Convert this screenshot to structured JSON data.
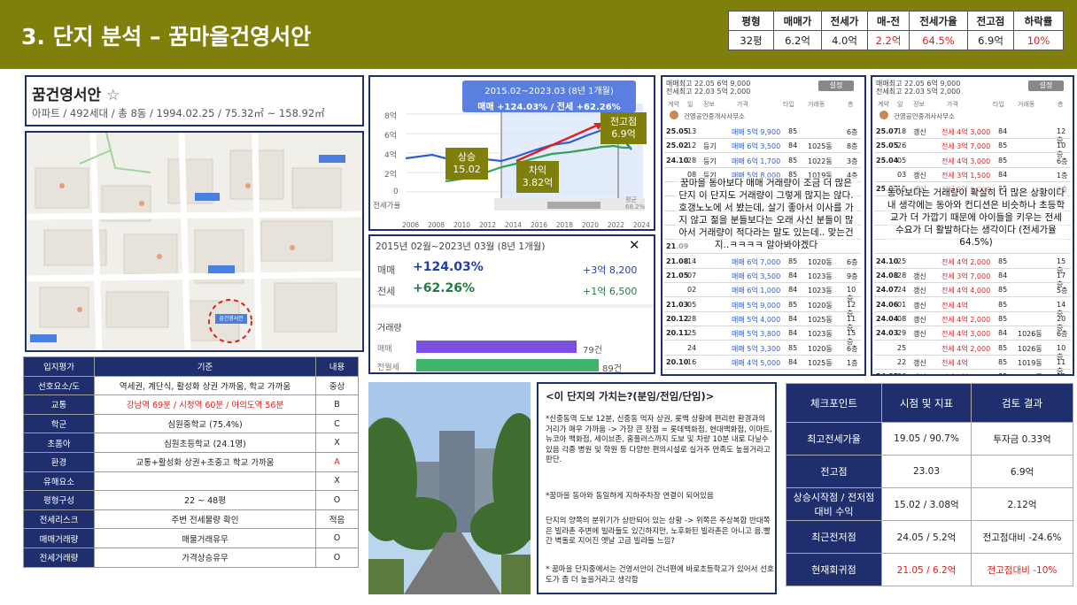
{
  "header": {
    "title": "3. 단지 분석 – 꿈마을건영서안"
  },
  "stats": {
    "headers": [
      "평형",
      "매매가",
      "전세가",
      "매-전",
      "전세가율",
      "전고점",
      "하락률"
    ],
    "values": [
      "32평",
      "6.2억",
      "4.0억",
      "2.2억",
      "64.5%",
      "6.9억",
      "10%"
    ]
  },
  "info": {
    "name": "꿈건영서안",
    "star": "☆",
    "desc": "아파트 / 492세대 / 총 8동 / 1994.02.25 / 75.32㎡ ~ 158.92㎡"
  },
  "map": {
    "pin": "꿈건영서안"
  },
  "price_chart": {
    "tooltip_period": "2015.02~2023.03 (8년 1개월)",
    "tooltip_change": "매매 +124.03% / 전세 +62.26%",
    "y_ticks": [
      "8억",
      "6억",
      "4억",
      "2억",
      "0"
    ],
    "y_label": "전세가율",
    "x_ticks": [
      "2006",
      "2008",
      "2010",
      "2012",
      "2014",
      "2016",
      "2018",
      "2020",
      "2022",
      "2024"
    ],
    "right_label": "평균",
    "right_value": "68.2%",
    "callouts": {
      "rise": "상승\n15.02",
      "gap": "차익\n3.82억",
      "peak": "전고점\n6.9억"
    }
  },
  "change_panel": {
    "period": "2015년 02월~2023년 03월 (8년 1개월)",
    "close": "✕",
    "sale_label": "매매",
    "sale_pct": "+124.03%",
    "sale_amt": "+3억 8,200",
    "jeonse_label": "전세",
    "jeonse_pct": "+62.26%",
    "jeonse_amt": "+1억 6,500",
    "volume_title": "거래량",
    "vol_sale_label": "매매",
    "vol_sale_val": "79건",
    "vol_jeonse_label": "전월세",
    "vol_jeonse_val": "89건",
    "vol_sale_ratio": 0.88,
    "vol_jeonse_ratio": 1.0
  },
  "list1": {
    "top1": "매매최고 22.05 6억 9,000",
    "top2": "전세최고 22.03 5억 2,000",
    "btn": "설정",
    "cols": [
      "계약",
      "일",
      "정보",
      "가격",
      "타입",
      "거래동",
      "층"
    ],
    "agent": "건영공인중개사사무소",
    "rows": [
      [
        "25.05",
        "13",
        "",
        "매매 5억 9,900",
        "85",
        "",
        "6층"
      ],
      [
        "25.02",
        "12",
        "등기",
        "매매 6억 3,500",
        "84",
        "1025동",
        "8층"
      ],
      [
        "24.10",
        "28",
        "등기",
        "매매 6억 1,700",
        "85",
        "1022동",
        "3층"
      ],
      [
        "",
        "08",
        "등기",
        "매매 5억 8,000",
        "85",
        "1019동",
        "4층"
      ],
      [
        "",
        "",
        "",
        "",
        "",
        "",
        ""
      ],
      [
        "",
        "",
        "",
        "",
        "",
        "",
        ""
      ],
      [
        "",
        "",
        "",
        "",
        "",
        "",
        ""
      ],
      [
        "",
        "",
        "",
        "",
        "",
        "",
        ""
      ],
      [
        "21.09",
        "",
        "",
        "",
        "",
        "",
        ""
      ],
      [
        "21.08",
        "14",
        "",
        "매매 6억 7,000",
        "85",
        "1020동",
        "6층"
      ],
      [
        "21.05",
        "07",
        "",
        "매매 6억 3,500",
        "84",
        "1023동",
        "9층"
      ],
      [
        "",
        "02",
        "",
        "매매 6억 1,000",
        "84",
        "1023동",
        "10층"
      ],
      [
        "21.03",
        "05",
        "",
        "매매 5억 9,000",
        "85",
        "1020동",
        "12층"
      ],
      [
        "20.12",
        "28",
        "",
        "매매 5억 4,000",
        "84",
        "1025동",
        "11층"
      ],
      [
        "20.11",
        "25",
        "",
        "매매 5억 3,800",
        "84",
        "1023동",
        "15층"
      ],
      [
        "",
        "24",
        "",
        "매매 5억 3,300",
        "85",
        "1020동",
        "6층"
      ],
      [
        "20.10",
        "16",
        "",
        "매매 4억 5,000",
        "84",
        "1025동",
        "1층"
      ]
    ],
    "note": "꿈마을 동아보다 매매 거래량이 조금 더 많은 단지 이 단지도 거래량이 그렇게 많지는 않다. 호갱노노에 서 봤는데, 살기 좋아서 이사를 가지 않고 젊을 분들보다는 오래 사신 분들이 많아서 거래량이 적다라는 말도 있는데.. 맞는건지..ㅋㅋㅋㅋ 알아봐야겠다"
  },
  "list2": {
    "top1": "매매최고 22.05 6억 9,000",
    "top2": "전세최고 22.03 5억 2,000",
    "btn": "설정",
    "cols": [
      "계약",
      "일",
      "정보",
      "가격",
      "타입",
      "거래동",
      "층"
    ],
    "agent": "건영공인중개사사무소",
    "rows": [
      [
        "25.07",
        "18",
        "갱신",
        "전세 4억 3,000",
        "84",
        "",
        "12층"
      ],
      [
        "25.05",
        "26",
        "",
        "전세 3억 7,000",
        "85",
        "",
        "10층"
      ],
      [
        "25.04",
        "05",
        "",
        "전세 4억 3,000",
        "85",
        "",
        "6층"
      ],
      [
        "",
        "03",
        "갱신",
        "전세 3억 1,500",
        "84",
        "",
        "1층"
      ],
      [
        "25.03",
        "15",
        "갱신",
        "전세 3억 5,000",
        "85",
        "",
        "3층"
      ],
      [
        "",
        "",
        "",
        "",
        "",
        "",
        ""
      ],
      [
        "",
        "",
        "",
        "",
        "",
        "",
        ""
      ],
      [
        "",
        "",
        "",
        "",
        "",
        "",
        ""
      ],
      [
        "",
        "",
        "",
        "",
        "",
        "",
        ""
      ],
      [
        "24.10",
        "25",
        "",
        "전세 4억 2,000",
        "85",
        "",
        "15층"
      ],
      [
        "24.08",
        "28",
        "갱신",
        "전세 3억 7,000",
        "84",
        "",
        "17층"
      ],
      [
        "24.07",
        "24",
        "갱신",
        "전세 4억 4,000",
        "85",
        "",
        "5층"
      ],
      [
        "24.06",
        "01",
        "갱신",
        "전세 4억",
        "85",
        "",
        "14층"
      ],
      [
        "24.04",
        "08",
        "갱신",
        "전세 4억 2,000",
        "85",
        "",
        "20층"
      ],
      [
        "24.03",
        "29",
        "갱신",
        "전세 4억 3,000",
        "84",
        "1026동",
        "6층"
      ],
      [
        "",
        "25",
        "",
        "전세 4억 2,000",
        "85",
        "1026동",
        "10층"
      ],
      [
        "",
        "22",
        "갱신",
        "전세 4억",
        "85",
        "1019동",
        "11층"
      ],
      [
        "24.02",
        "20",
        "갱신",
        "전세 4억 2,000",
        "85",
        "1020동",
        "18층"
      ]
    ],
    "note": "동아보다는 거래량이 확실히 더 많은 상황이다 내 생각에는 동아와 컨디션은 비슷하나 초등학교가 더 가깝기 때문에 아이들을 키우는 전세 수요가 더 활발하다는 생각이다 (전세가율 64.5%)"
  },
  "location_table": {
    "headers": [
      "입지평가",
      "기준",
      "내용"
    ],
    "rows": [
      [
        "선호요소/도",
        "역세권, 계단식, 활성화 상권 가까움, 학교 가까움",
        "중상"
      ],
      [
        "교통",
        "강남역 69분 / 시청역 60분 / 여의도역 56분",
        "B"
      ],
      [
        "학군",
        "심원중학교 (75.4%)",
        "C"
      ],
      [
        "초품아",
        "심원초등학교 (24.1명)",
        "X"
      ],
      [
        "환경",
        "교통+활성화 상권+초중고 학교 가까움",
        "A"
      ],
      [
        "유해요소",
        "",
        "X"
      ],
      [
        "평형구성",
        "22 ~ 48평",
        "O"
      ],
      [
        "전세리스크",
        "주변 전세물량 확인",
        "적음"
      ],
      [
        "매매거래량",
        "매물거래유무",
        "O"
      ],
      [
        "전세거래량",
        "가격상승유무",
        "O"
      ]
    ]
  },
  "value_box": {
    "title": "<이 단지의 가치는?(분임/전임/단임)>",
    "paragraphs": [
      "*신중동역 도보 12분, 신중동 먹자 상권, 롯백 상황에 편리한 환경과의 거리가 매우 가까움 -> 가장 큰 장점 = 롯데백화점, 현대백화점, 이마트, 뉴코아 백화점, 세이브존, 홈플러스까지 도보 및 차량 10분 내로 다닐수 있음 각종 병원 및 학원 등 다양한 편의시설로 실거주 만족도 높을거라고 판단.",
      "*꿈마을 동아와 동일하게 지하주차장 연결이 되어있음",
      "단지의 양쪽의 분위기가 상반되어 있는 상황 -> 위쪽은 주상복합 반대쪽은 빌라촌 주변에 빌라들도 있긴하지만, 노후화된 빌라촌은 아니고 음.빨간 벽돌로 지어진 옛날 고급 빌라들 느낌?",
      "* 꿈마을 단지중에서는 건영서안이 건너편에 바로초등학교가 있어서 선호도가 좀 더 높을거라고 생각함"
    ]
  },
  "check_table": {
    "headers": [
      "체크포인트",
      "시점 및 지표",
      "검토 결과"
    ],
    "rows": [
      [
        "최고전세가율",
        "19.05 / 90.7%",
        "투자금 0.33억"
      ],
      [
        "전고점",
        "23.03",
        "6.9억"
      ],
      [
        "상승시작점 / 전저점대비 수익",
        "15.02 / 3.08억",
        "2.12억"
      ],
      [
        "최근전저점",
        "24.05 / 5.2억",
        "전고점대비 -24.6%"
      ],
      [
        "현재회귀점",
        "21.05 / 6.2억",
        "전고점대비 -10%"
      ]
    ]
  },
  "colors": {
    "header_bg": "#7f7f0c",
    "navy": "#1f2f6e",
    "red": "#e02020",
    "sale": "#7b4fe0",
    "jeonse": "#3db36b"
  }
}
